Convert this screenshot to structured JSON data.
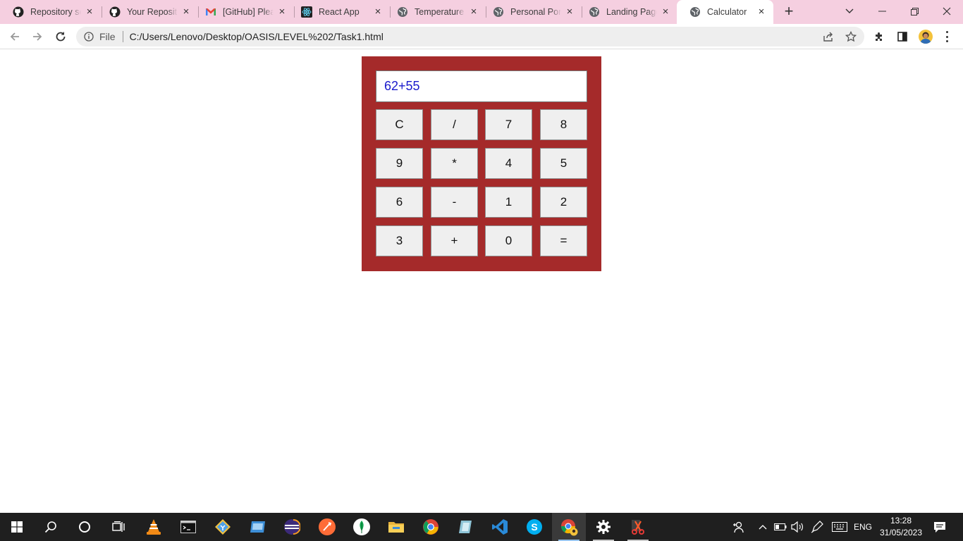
{
  "browser": {
    "tabs": [
      {
        "label": "Repository se",
        "icon": "github-icon"
      },
      {
        "label": "Your Reposito",
        "icon": "github-icon"
      },
      {
        "label": "[GitHub] Plea",
        "icon": "gmail-icon"
      },
      {
        "label": "React App",
        "icon": "react-icon"
      },
      {
        "label": "Temperature",
        "icon": "globe-icon"
      },
      {
        "label": "Personal Port",
        "icon": "globe-icon"
      },
      {
        "label": "Landing Page",
        "icon": "globe-icon"
      },
      {
        "label": "Calculator",
        "icon": "globe-icon",
        "active": true
      }
    ],
    "address": {
      "scheme_label": "File",
      "url": "C:/Users/Lenovo/Desktop/OASIS/LEVEL%202/Task1.html"
    }
  },
  "calculator": {
    "display_value": "62+55",
    "keys": [
      "C",
      "/",
      "7",
      "8",
      "9",
      "*",
      "4",
      "5",
      "6",
      "-",
      "1",
      "2",
      "3",
      "+",
      "0",
      "="
    ]
  },
  "taskbar": {
    "language": "ENG",
    "time": "13:28",
    "date": "31/05/2023"
  },
  "colors": {
    "tabstrip": "#f5cfe0",
    "calculator_body": "#a52a2a",
    "display_text": "#1a1acc",
    "key_bg": "#efefef",
    "taskbar": "#1f1f1f"
  }
}
